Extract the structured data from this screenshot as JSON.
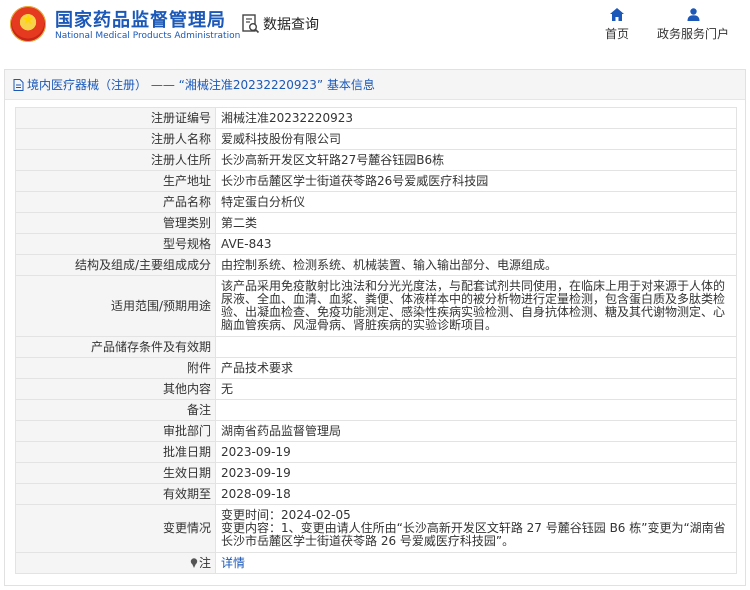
{
  "header": {
    "brand_cn": "国家药品监督管理局",
    "brand_en": "National Medical Products Administration",
    "data_query": "数据查询",
    "nav": {
      "home": "首页",
      "gov_service": "政务服务门户"
    }
  },
  "panel": {
    "title": "境内医疗器械（注册） —— “湘械注准20232220923” 基本信息"
  },
  "rows": [
    {
      "label": "注册证编号",
      "value": "湘械注准20232220923"
    },
    {
      "label": "注册人名称",
      "value": "爱威科技股份有限公司"
    },
    {
      "label": "注册人住所",
      "value": "长沙高新开发区文轩路27号麓谷钰园B6栋"
    },
    {
      "label": "生产地址",
      "value": "长沙市岳麓区学士街道茯苓路26号爱威医疗科技园"
    },
    {
      "label": "产品名称",
      "value": "特定蛋白分析仪"
    },
    {
      "label": "管理类别",
      "value": "第二类"
    },
    {
      "label": "型号规格",
      "value": "AVE-843"
    },
    {
      "label": "结构及组成/主要组成成分",
      "value": "由控制系统、检测系统、机械装置、输入输出部分、电源组成。"
    },
    {
      "label": "适用范围/预期用途",
      "value": "该产品采用免疫散射比浊法和分光光度法，与配套试剂共同使用，在临床上用于对来源于人体的尿液、全血、血清、血浆、粪便、体液样本中的被分析物进行定量检测，包含蛋白质及多肽类检验、出凝血检查、免疫功能测定、感染性疾病实验检测、自身抗体检测、糖及其代谢物测定、心脑血管疾病、风湿骨病、肾脏疾病的实验诊断项目。"
    },
    {
      "label": "产品储存条件及有效期",
      "value": ""
    },
    {
      "label": "附件",
      "value": "产品技术要求"
    },
    {
      "label": "其他内容",
      "value": "无"
    },
    {
      "label": "备注",
      "value": ""
    },
    {
      "label": "审批部门",
      "value": "湖南省药品监督管理局"
    },
    {
      "label": "批准日期",
      "value": "2023-09-19"
    },
    {
      "label": "生效日期",
      "value": "2023-09-19"
    },
    {
      "label": "有效期至",
      "value": "2028-09-18"
    }
  ],
  "change": {
    "label": "变更情况",
    "time": "变更时间：2024-02-05",
    "content": "变更内容：1、变更由请人住所由“长沙高新开发区文轩路 27 号麓谷钰园 B6 栋”变更为“湖南省长沙市岳麓区学士街道茯苓路 26 号爱威医疗科技园”。"
  },
  "note": {
    "label": "注",
    "link": "详情"
  }
}
